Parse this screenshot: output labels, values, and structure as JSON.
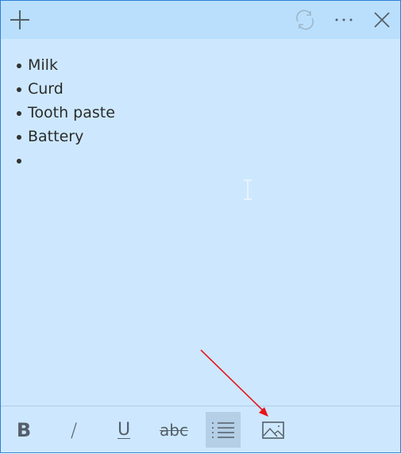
{
  "titlebar": {
    "new_note_icon": "plus-icon",
    "sync_icon": "sync-icon",
    "more_icon": "ellipsis-icon",
    "close_icon": "close-icon"
  },
  "note": {
    "items": [
      "Milk",
      "Curd",
      "Tooth paste",
      "Battery",
      ""
    ]
  },
  "toolbar": {
    "bold": "B",
    "italic": "/",
    "underline": "U",
    "strikethrough": "abc",
    "bullets_active": true,
    "image_icon": "image-icon"
  },
  "colors": {
    "titlebar": "#b9dffd",
    "body": "#cde8fe",
    "active_button": "#b4cfe6",
    "annotation_arrow": "#e8141c"
  }
}
